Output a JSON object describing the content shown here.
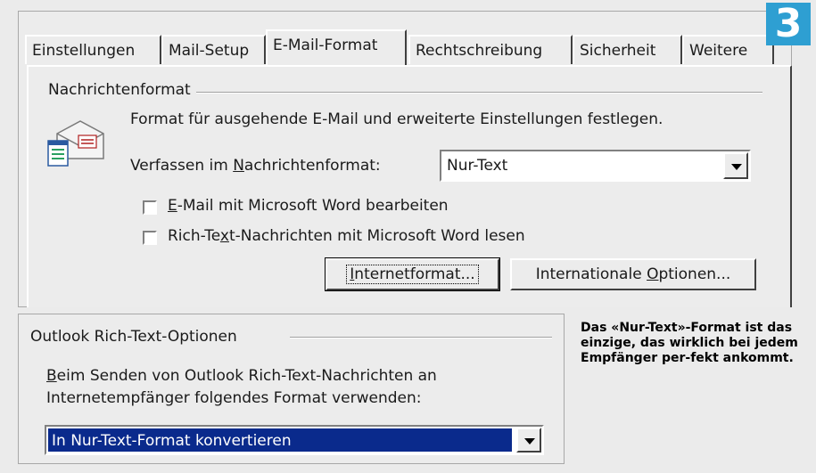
{
  "badge": "3",
  "tabs": [
    {
      "label": "Einstellungen",
      "active": false
    },
    {
      "label": "Mail-Setup",
      "active": false
    },
    {
      "label": "E-Mail-Format",
      "active": true
    },
    {
      "label": "Rechtschreibung",
      "active": false
    },
    {
      "label": "Sicherheit",
      "active": false
    },
    {
      "label": "Weitere",
      "active": false
    }
  ],
  "message_format": {
    "group_title": "Nachrichtenformat",
    "description": "Format für ausgehende E-Mail und erweiterte Einstellungen festlegen.",
    "compose_label_pre": "Verfassen im ",
    "compose_label_u": "N",
    "compose_label_post": "achrichtenformat:",
    "compose_value": "Nur-Text",
    "checkbox_word_edit_u": "E",
    "checkbox_word_edit_rest": "-Mail mit Microsoft Word bearbeiten",
    "checkbox_word_edit_checked": false,
    "checkbox_richtext_pre": "Rich-Te",
    "checkbox_richtext_u": "x",
    "checkbox_richtext_post": "t-Nachrichten mit Microsoft Word lesen",
    "checkbox_richtext_checked": false,
    "internet_btn_u": "I",
    "internet_btn_rest": "nternetformat...",
    "intl_btn_pre": "Internationale ",
    "intl_btn_u": "O",
    "intl_btn_post": "ptionen..."
  },
  "rich_text_options": {
    "group_title": "Outlook Rich-Text-Optionen",
    "desc_line1_u": "B",
    "desc_line1_rest": "eim Senden von Outlook Rich-Text-Nachrichten an",
    "desc_line2": "Internetempfänger folgendes Format verwenden:",
    "select_value": "In Nur-Text-Format konvertieren"
  },
  "caption": "Das «Nur-Text»-Format ist das einzige, das wirklich bei jedem Empfänger per-fekt ankommt.",
  "colors": {
    "badge": "#2e9fd2",
    "selection": "#0a2a8c"
  }
}
